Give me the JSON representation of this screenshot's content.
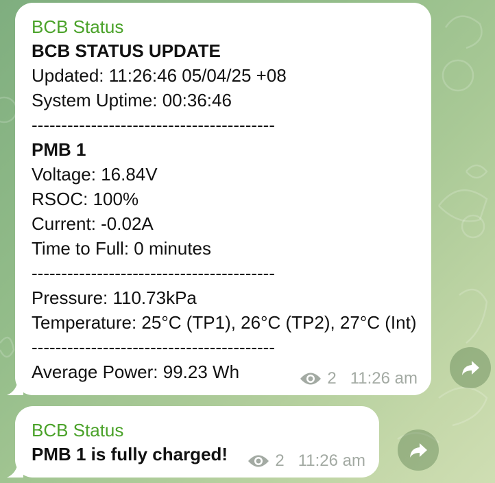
{
  "messages": [
    {
      "sender": "BCB Status",
      "lines": [
        "BCB STATUS UPDATE",
        "Updated: 11:26:46 05/04/25 +08",
        "System Uptime: 00:36:46",
        "-----------------------------------------",
        "PMB 1",
        "Voltage: 16.84V",
        "RSOC: 100%",
        "Current: -0.02A",
        "Time to Full: 0 minutes",
        "-----------------------------------------",
        "Pressure: 110.73kPa",
        "Temperature: 25°C (TP1), 26°C (TP2), 27°C (Int)",
        "-----------------------------------------",
        "Average Power: 99.23 Wh"
      ],
      "views": "2",
      "time": "11:26 am"
    },
    {
      "sender": "BCB Status",
      "lines": [
        "PMB 1 is fully charged!"
      ],
      "views": "2",
      "time": "11:26 am"
    }
  ],
  "icons": {
    "views": "eye-icon",
    "forward": "forward-arrow-icon"
  },
  "colors": {
    "sender": "#4aa229",
    "meta": "#a3aaa3",
    "bubble": "#ffffff",
    "background": "#94bd8a"
  }
}
